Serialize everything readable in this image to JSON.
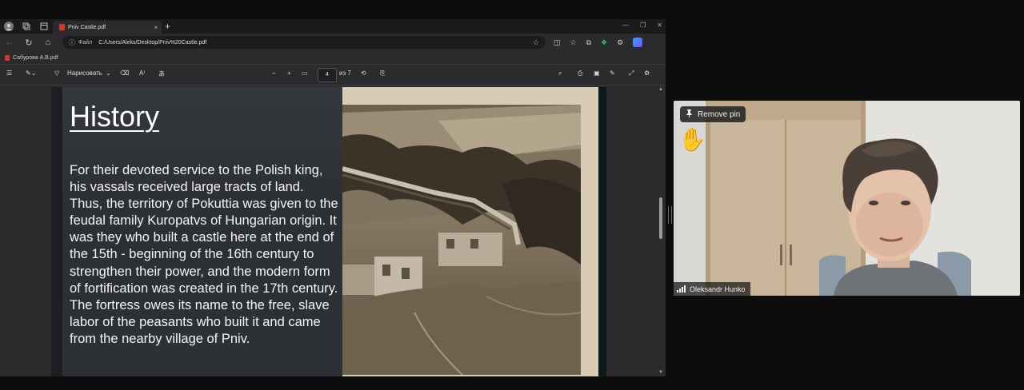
{
  "browser": {
    "tab_title": "Pniv Castle.pdf",
    "tab_close": "×",
    "new_tab": "+",
    "url_scheme": "Файл",
    "url": "C:/Users/Aleks/Desktop/Pniv%20Castle.pdf",
    "favorite": "Сабурова А.В.pdf"
  },
  "pdf_toolbar": {
    "draw_label": "Нарисовать",
    "page_current": "4",
    "page_total": "из 7",
    "zoom_out": "−",
    "zoom_in": "+"
  },
  "slide": {
    "title": "History",
    "body": "For their devoted service to the Polish king, his vassals received large tracts of land. Thus, the territory of Pokuttia was given to the feudal family Kuropatvs of Hungarian origin. It was they who built a castle here at the end of the 15th - beginning of the 16th century to strengthen their power, and the modern form of fortification was created in the 17th century. The fortress owes its name to the free, slave labor of the peasants who built it and came from the nearby village of Pniv."
  },
  "video": {
    "remove_pin_label": "Remove pin",
    "participant_name": "Oleksandr Hunko",
    "raised_hand": "✋"
  }
}
